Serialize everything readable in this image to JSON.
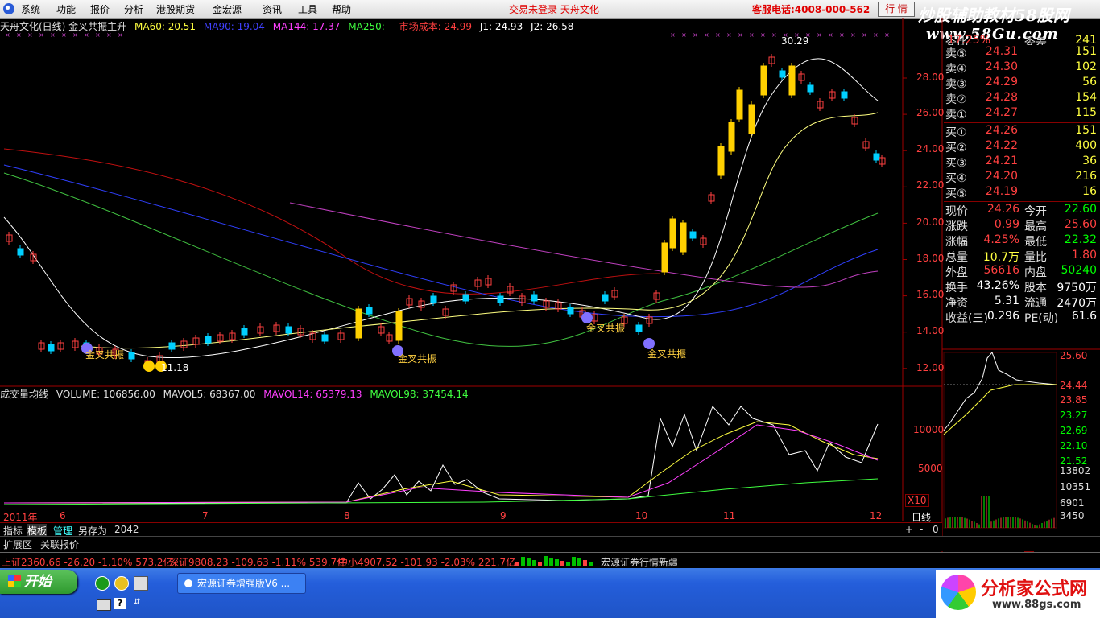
{
  "menu": {
    "items": [
      "系统",
      "功能",
      "报价",
      "分析",
      "港股期货",
      "金宏源",
      "资讯",
      "工具",
      "帮助"
    ],
    "notice": "交易未登录  天舟文化",
    "hotline": "客服电话:4008-000-562",
    "trade_label": "行 情"
  },
  "watermark": {
    "title": "炒股辅助教材58股网",
    "url": "www.58Gu.com"
  },
  "chart_header": {
    "stock": "天舟文化(日线) 金叉共振主升",
    "ma60": "MA60: 20.51",
    "ma90": "MA90: 19.04",
    "ma144": "MA144: 17.37",
    "ma250": "MA250: -",
    "cost": "市场成本: 24.99",
    "j1": "J1: 24.93",
    "j2": "J2: 26.58"
  },
  "price_axis": [
    "28.00",
    "26.00",
    "24.00",
    "22.00",
    "20.00",
    "18.00",
    "16.00",
    "14.00",
    "12.00"
  ],
  "annotations": {
    "high": "30.29",
    "low": "11.18",
    "signal1": "金叉共振",
    "signal2": "金叉共振",
    "signal3": "金叉共振",
    "signal4": "金叉共振"
  },
  "volume_header": {
    "title": "成交量均线",
    "volume": "VOLUME: 106856.00",
    "mavol5": "MAVOL5: 68367.00",
    "mavol14": "MAVOL14: 65379.13",
    "mavol98": "MAVOL98: 37454.14"
  },
  "volume_axis": [
    "10000",
    "5000"
  ],
  "volume_unit": "X10",
  "date_axis": [
    "2011年",
    "6",
    "7",
    "8",
    "9",
    "10",
    "11",
    "12"
  ],
  "period": "日线",
  "quote": {
    "ratio_label": "委比",
    "ratio_val": "17.25%",
    "diff_label": "委差",
    "diff_val": "241",
    "sells": [
      {
        "label": "卖⑤",
        "price": "24.31",
        "vol": "151"
      },
      {
        "label": "卖④",
        "price": "24.30",
        "vol": "102"
      },
      {
        "label": "卖③",
        "price": "24.29",
        "vol": "56"
      },
      {
        "label": "卖②",
        "price": "24.28",
        "vol": "154"
      },
      {
        "label": "卖①",
        "price": "24.27",
        "vol": "115"
      }
    ],
    "buys": [
      {
        "label": "买①",
        "price": "24.26",
        "vol": "151"
      },
      {
        "label": "买②",
        "price": "24.22",
        "vol": "400"
      },
      {
        "label": "买③",
        "price": "24.21",
        "vol": "36"
      },
      {
        "label": "买④",
        "price": "24.20",
        "vol": "216"
      },
      {
        "label": "买⑤",
        "price": "24.19",
        "vol": "16"
      }
    ],
    "stats": [
      {
        "l1": "现价",
        "v1": "24.26",
        "l2": "今开",
        "v2": "22.60"
      },
      {
        "l1": "涨跌",
        "v1": "0.99",
        "l2": "最高",
        "v2": "25.60"
      },
      {
        "l1": "涨幅",
        "v1": "4.25%",
        "l2": "最低",
        "v2": "22.32"
      },
      {
        "l1": "总量",
        "v1": "10.7万",
        "l2": "量比",
        "v2": "1.80"
      },
      {
        "l1": "外盘",
        "v1": "56616",
        "l2": "内盘",
        "v2": "50240"
      },
      {
        "l1": "换手",
        "v1": "43.26%",
        "l2": "股本",
        "v2": "9750万"
      },
      {
        "l1": "净资",
        "v1": "5.31",
        "l2": "流通",
        "v2": "2470万"
      },
      {
        "l1": "收益(三)",
        "v1": "0.296",
        "l2": "PE(动)",
        "v2": "61.6"
      }
    ]
  },
  "mini_chart": {
    "price_axis": [
      "25.60",
      "24.44",
      "23.85",
      "23.27",
      "22.69",
      "22.10",
      "21.52"
    ],
    "vol_axis": [
      "13802",
      "10351",
      "6901",
      "3450"
    ]
  },
  "bottom_tabs": [
    "指标",
    "模板",
    "管理",
    "另存为",
    "2042"
  ],
  "ext_tabs": [
    "扩展区",
    "关联报价"
  ],
  "right_tabs": [
    "笔",
    "价",
    "细",
    "盘",
    "势",
    "指",
    "值",
    "筹"
  ],
  "index_bar": {
    "sh": "上证2360.66  -26.20  -1.10%  573.2亿",
    "sz": "深证9808.23  -109.63  -1.11%  539.7亿",
    "zx": "中小4907.52  -101.93  -2.03%  221.7亿",
    "broker": "宏源证券行情新疆一"
  },
  "taskbar": {
    "start": "开始",
    "task": "宏源证券增强版V6 ..."
  },
  "brand": {
    "name": "分析家公式网",
    "url": "www.88gs.com"
  },
  "chart_data": {
    "type": "candlestick",
    "x": [
      "2011-05",
      "2011-06",
      "2011-07",
      "2011-08",
      "2011-09",
      "2011-10",
      "2011-11",
      "2011-12"
    ],
    "close_approx": [
      19.0,
      13.2,
      13.8,
      14.6,
      15.6,
      14.6,
      28.2,
      24.26
    ],
    "ylim": [
      11.5,
      31.0
    ],
    "volume_ylim": [
      0,
      13802
    ]
  }
}
